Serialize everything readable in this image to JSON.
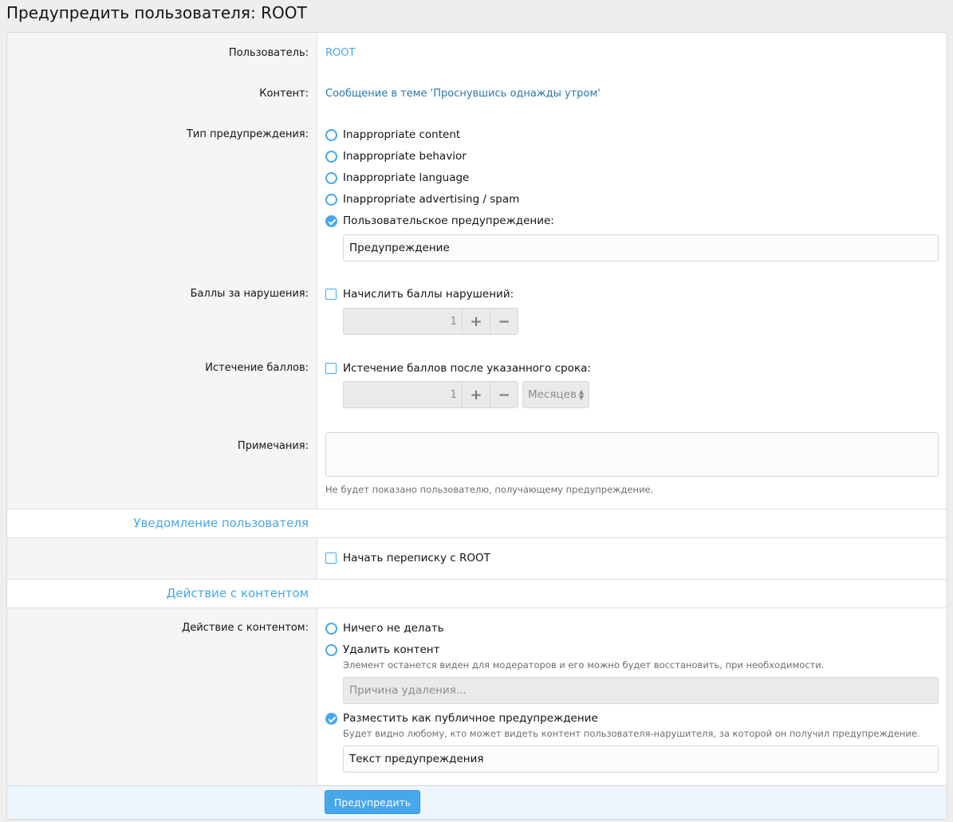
{
  "page": {
    "title": "Предупредить пользователя: ROOT"
  },
  "user": {
    "label": "Пользователь:",
    "value": "ROOT"
  },
  "content": {
    "label": "Контент:",
    "value": "Сообщение в теме 'Проснувшись однажды утром'"
  },
  "warning_type": {
    "label": "Тип предупреждения:",
    "options": [
      {
        "label": "Inappropriate content",
        "checked": false
      },
      {
        "label": "Inappropriate behavior",
        "checked": false
      },
      {
        "label": "Inappropriate language",
        "checked": false
      },
      {
        "label": "Inappropriate advertising / spam",
        "checked": false
      },
      {
        "label": "Пользовательское предупреждение:",
        "checked": true
      }
    ],
    "custom_value": "Предупреждение"
  },
  "points": {
    "label": "Баллы за нарушения:",
    "checkbox_label": "Начислить баллы нарушений:",
    "value": "1",
    "plus": "+",
    "minus": "−"
  },
  "expiry": {
    "label": "Истечение баллов:",
    "checkbox_label": "Истечение баллов после указанного срока:",
    "value": "1",
    "plus": "+",
    "minus": "−",
    "unit": "Месяцев"
  },
  "notes": {
    "label": "Примечания:",
    "value": "",
    "hint": "Не будет показано пользователю, получающему предупреждение."
  },
  "notify": {
    "heading": "Уведомление пользователя",
    "checkbox_label": "Начать переписку с ROOT"
  },
  "content_action": {
    "heading": "Действие с контентом",
    "label": "Действие с контентом:",
    "opt_nothing": "Ничего не делать",
    "opt_delete": "Удалить контент",
    "delete_hint": "Элемент останется виден для модераторов и его можно будет восстановить, при необходимости.",
    "delete_reason_placeholder": "Причина удаления...",
    "opt_public": "Разместить как публичное предупреждение",
    "public_hint": "Будет видно любому, кто может видеть контент пользователя-нарушителя, за которой он получил предупреждение.",
    "public_text": "Текст предупреждения"
  },
  "submit": {
    "label": "Предупредить"
  },
  "colors": {
    "accent": "#47a7eb",
    "link": "#2577b1"
  }
}
